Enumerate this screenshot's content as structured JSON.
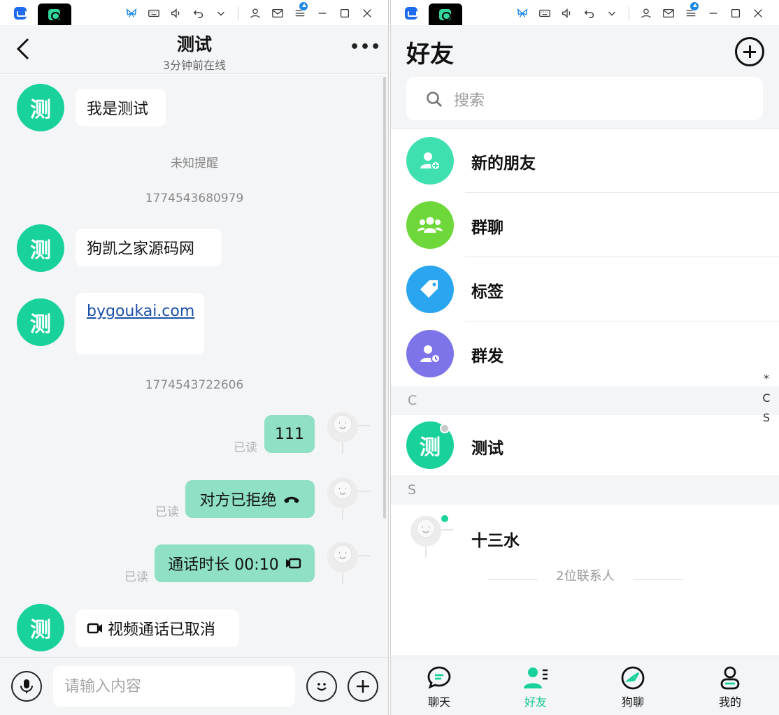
{
  "chat": {
    "title": "测试",
    "subtitle": "3分钟前在线",
    "more": "•••",
    "avatar_char": "测",
    "messages": {
      "m1": "我是测试",
      "sys1": "未知提醒",
      "ts1": "1774543680979",
      "m2": "狗凯之家源码网",
      "m3_link": "bygoukai.com",
      "ts2": "1774543722606",
      "o1": "111",
      "o2": "对方已拒绝",
      "o3": "通话时长 00:10",
      "m4": "视频通话已取消"
    },
    "read_label": "已读",
    "input_placeholder": "请输入内容"
  },
  "friends": {
    "title": "好友",
    "search_placeholder": "搜索",
    "entries": {
      "new_friends": "新的朋友",
      "group_chat": "群聊",
      "tags": "标签",
      "broadcast": "群发"
    },
    "sections": {
      "c": "C",
      "s": "S"
    },
    "contacts": {
      "ceshi": "测试",
      "ceshi_avatar": "测",
      "shisanshui": "十三水"
    },
    "index": [
      "*",
      "C",
      "S"
    ],
    "count_text": "2位联系人",
    "nav": {
      "chat": "聊天",
      "friends": "好友",
      "goulao": "狗聊",
      "me": "我的"
    }
  },
  "colors": {
    "accent": "#19d19a",
    "outgoing_bubble": "#8fe0c4",
    "background": "#f4f5f7",
    "link": "#1c4fa8"
  }
}
